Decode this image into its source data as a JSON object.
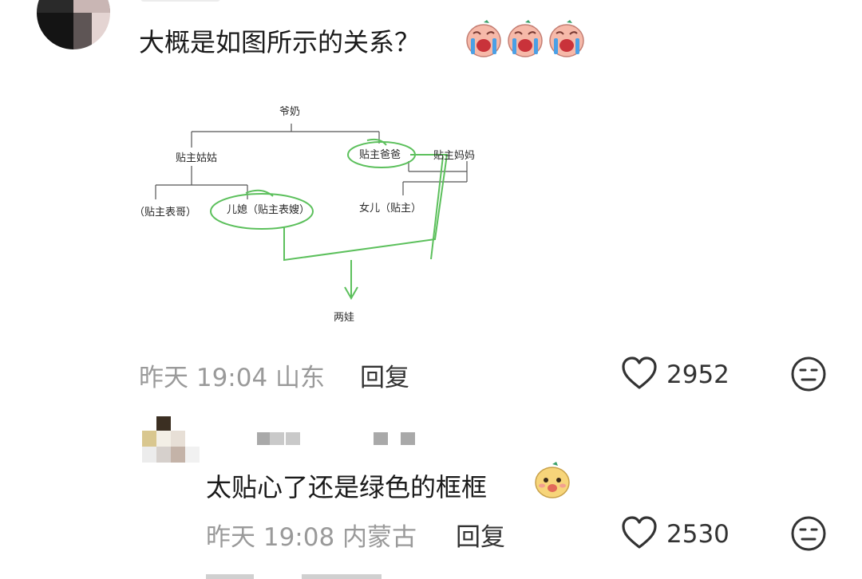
{
  "comments": [
    {
      "text": "大概是如图所示的关系？",
      "emojis": [
        "crying-face",
        "crying-face",
        "crying-face"
      ],
      "time": "昨天 19:04 山东",
      "reply_label": "回复",
      "like_count": "2952",
      "diagram": {
        "nodes": [
          "爷奶",
          "贴主姑姑",
          "贴主爸爸",
          "贴主妈妈",
          "（贴主表哥）",
          "儿媳（贴主表嫂）",
          "女儿（贴主）",
          "两娃"
        ],
        "highlight_color": "#5cc05c"
      }
    },
    {
      "text": "太贴心了还是绿色的框框",
      "emojis": [
        "smiling-face"
      ],
      "time": "昨天 19:08 内蒙古",
      "reply_label": "回复",
      "like_count": "2530"
    }
  ]
}
